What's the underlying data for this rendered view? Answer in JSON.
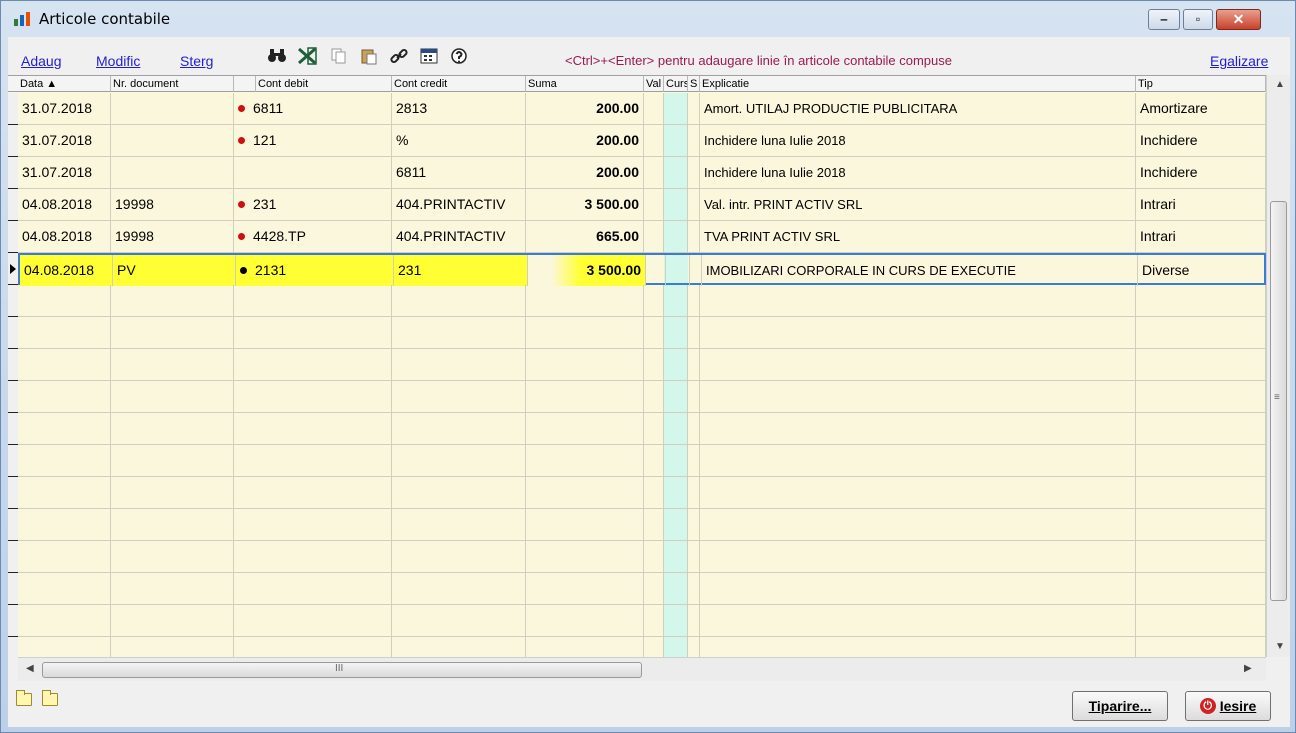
{
  "window": {
    "title": "Articole contabile",
    "min_label": "‒",
    "max_label": "▫",
    "close_label": "✕"
  },
  "toolbar": {
    "add_label": "Adaug",
    "modify_label": "Modific",
    "delete_label": "Sterg",
    "icons": [
      "binoculars-icon",
      "excel-icon",
      "copy-icon",
      "paste-icon",
      "link-icon",
      "calculator-icon",
      "help-icon"
    ],
    "hint": "<Ctrl>+<Enter> pentru adaugare linie în articole contabile compuse",
    "balance_label": "Egalizare"
  },
  "columns": [
    "Data ▲",
    "Nr. document",
    "Cont debit",
    "Cont credit",
    "Suma",
    "Val",
    "Curs",
    "S",
    "Explicatie",
    "Tip"
  ],
  "rows": [
    {
      "data": "31.07.2018",
      "nr": "",
      "dot": "red",
      "debit": "6811",
      "credit": "2813",
      "suma": "200.00",
      "explicatie": "Amort. UTILAJ PRODUCTIE PUBLICITARA",
      "tip": "Amortizare"
    },
    {
      "data": "31.07.2018",
      "nr": "",
      "dot": "red",
      "debit": "121",
      "credit": "%",
      "suma": "200.00",
      "explicatie": "Inchidere luna Iulie     2018",
      "tip": "Inchidere"
    },
    {
      "data": "31.07.2018",
      "nr": "",
      "dot": "",
      "debit": "",
      "credit": "6811",
      "suma": "200.00",
      "explicatie": "Inchidere luna Iulie     2018",
      "tip": "Inchidere"
    },
    {
      "data": "04.08.2018",
      "nr": "19998",
      "dot": "red",
      "debit": "231",
      "credit": "404.PRINTACTIV",
      "suma": "3 500.00",
      "explicatie": "Val. intr. PRINT ACTIV SRL",
      "tip": "Intrari"
    },
    {
      "data": "04.08.2018",
      "nr": "19998",
      "dot": "red",
      "debit": "4428.TP",
      "credit": "404.PRINTACTIV",
      "suma": "665.00",
      "explicatie": "TVA PRINT ACTIV SRL",
      "tip": "Intrari"
    },
    {
      "data": "04.08.2018",
      "nr": "PV",
      "dot": "black",
      "debit": "2131",
      "credit": "231",
      "suma": "3 500.00",
      "explicatie": "IMOBILIZARI CORPORALE IN CURS DE EXECUTIE",
      "tip": "Diverse"
    }
  ],
  "scrollbar": {
    "grip": "≡",
    "hgrip": "III"
  },
  "bottom": {
    "print_label": "Tiparire...",
    "exit_label": "Iesire"
  },
  "colors": {
    "highlight": "#ffff33",
    "hint": "#9b1a50",
    "link": "#1f1fd6",
    "selection_border": "#3a7bd5",
    "grid_bg": "#fbf7dd",
    "curs_column": "#d4f7ec"
  }
}
